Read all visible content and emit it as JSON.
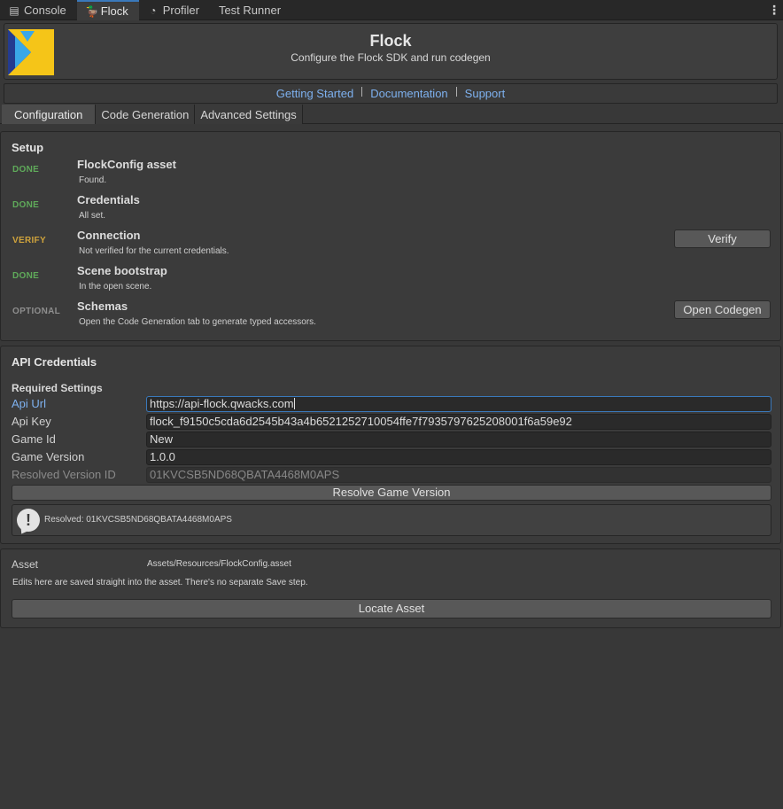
{
  "editor_tabs": [
    {
      "label": "Console",
      "icon": "console-icon",
      "glyph": "▤"
    },
    {
      "label": "Flock",
      "icon": "duck-icon",
      "glyph": "🦆"
    },
    {
      "label": "Profiler",
      "icon": "profiler-gauge-icon",
      "glyph": "◔"
    },
    {
      "label": "Test Runner",
      "icon": "",
      "glyph": ""
    }
  ],
  "header": {
    "title": "Flock",
    "subtitle": "Configure the Flock SDK and run codegen",
    "logo_colors": {
      "yellow": "#f5c518",
      "blue": "#3aa7e8",
      "navy": "#243b8f"
    }
  },
  "links": [
    "Getting Started",
    "Documentation",
    "Support"
  ],
  "tabs": [
    "Configuration",
    "Code Generation",
    "Advanced Settings"
  ],
  "setup": {
    "title": "Setup",
    "rows": [
      {
        "status": "DONE",
        "title": "FlockConfig asset",
        "desc": "Found."
      },
      {
        "status": "DONE",
        "title": "Credentials",
        "desc": "All set."
      },
      {
        "status": "VERIFY",
        "title": "Connection",
        "desc": "Not verified for the current credentials.",
        "button": "Verify"
      },
      {
        "status": "DONE",
        "title": "Scene bootstrap",
        "desc": "In the open scene."
      },
      {
        "status": "OPTIONAL",
        "title": "Schemas",
        "desc": "Open the Code Generation tab to generate typed accessors.",
        "button": "Open Codegen"
      }
    ]
  },
  "credentials": {
    "title": "API Credentials",
    "required_title": "Required Settings",
    "fields": {
      "api_url": {
        "label": "Api Url",
        "value": "https://api-flock.qwacks.com"
      },
      "api_key": {
        "label": "Api Key",
        "value": "flock_f9150c5cda6d2545b43a4b6521252710054ffe7f7935797625208001f6a59e92"
      },
      "game_id": {
        "label": "Game Id",
        "value": "New"
      },
      "game_version": {
        "label": "Game Version",
        "value": "1.0.0"
      },
      "resolved_version": {
        "label": "Resolved Version ID",
        "value": "01KVCSB5ND68QBATA4468M0APS"
      }
    },
    "resolve_button": "Resolve Game Version",
    "help_text": "Resolved: 01KVCSB5ND68QBATA4468M0APS"
  },
  "asset": {
    "label": "Asset",
    "path": "Assets/Resources/FlockConfig.asset",
    "note": "Edits here are saved straight into the asset. There's no separate Save step.",
    "button": "Locate Asset"
  }
}
